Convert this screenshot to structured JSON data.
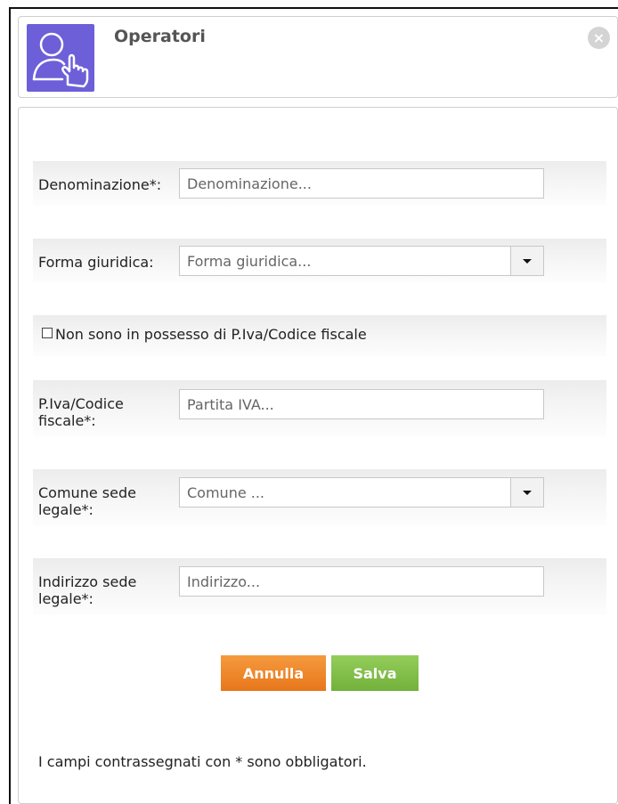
{
  "header": {
    "title": "Operatori",
    "close_symbol": "×",
    "app_icon": "hand-touch-icon",
    "icon_color": "#6d5fd8"
  },
  "form": {
    "denominazione": {
      "label": "Denominazione*:",
      "placeholder": "Denominazione..."
    },
    "forma_giuridica": {
      "label": "Forma giuridica:",
      "placeholder": "Forma giuridica..."
    },
    "no_piva": {
      "label": "Non sono in possesso di P.Iva/Codice fiscale",
      "checked": false
    },
    "piva": {
      "label_line1": "P.Iva/Codice",
      "label_line2": "fiscale*:",
      "placeholder": "Partita IVA..."
    },
    "comune": {
      "label_line1": "Comune sede",
      "label_line2": "legale*:",
      "placeholder": "Comune ..."
    },
    "indirizzo": {
      "label_line1": "Indirizzo sede",
      "label_line2": "legale*:",
      "placeholder": "Indirizzo..."
    }
  },
  "actions": {
    "cancel_label": "Annulla",
    "save_label": "Salva",
    "cancel_color": "#e8761b",
    "save_color": "#72b13b"
  },
  "footnote": "I campi contrassegnati con * sono obbligatori."
}
